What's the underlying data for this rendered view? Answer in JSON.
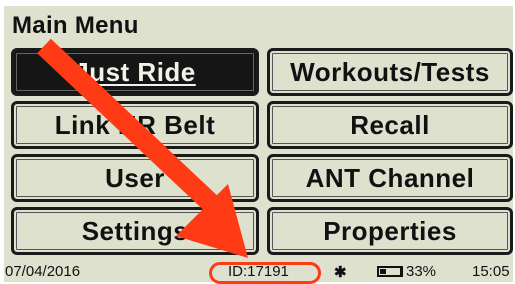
{
  "header": {
    "title": "Main Menu"
  },
  "menu": {
    "buttons": [
      {
        "label": "Just Ride",
        "selected": true
      },
      {
        "label": "Workouts/Tests"
      },
      {
        "label": "Link HR Belt"
      },
      {
        "label": "Recall"
      },
      {
        "label": "User"
      },
      {
        "label": "ANT Channel"
      },
      {
        "label": "Settings"
      },
      {
        "label": "Properties"
      }
    ]
  },
  "status_bar": {
    "date": "07/04/2016",
    "device_id": "ID:17191",
    "bluetooth_icon": "bluetooth-icon",
    "battery_icon": "battery-icon",
    "battery_percent": "33%",
    "battery_level": 0.33,
    "time": "15:05"
  },
  "annotation": {
    "color": "#ff3b15"
  }
}
